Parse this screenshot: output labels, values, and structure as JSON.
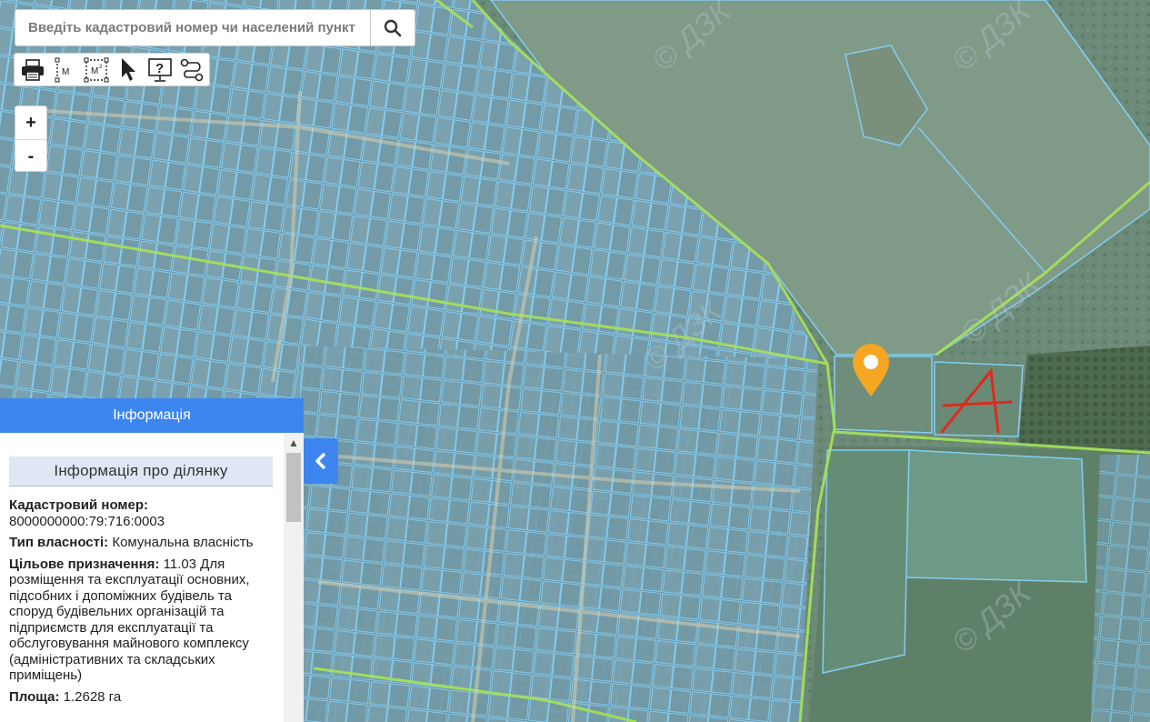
{
  "search": {
    "placeholder": "Введіть кадастровий номер чи населений пункт"
  },
  "toolbar": {
    "icons": [
      "printer-icon",
      "measure-distance-icon",
      "measure-area-icon",
      "pointer-icon",
      "help-icon",
      "route-icon"
    ],
    "measure_label": "M"
  },
  "zoom": {
    "plus": "+",
    "minus": "-"
  },
  "panel": {
    "header": "Інформація",
    "section_title": "Інформація про ділянку",
    "cadastral_label": "Кадастровий номер:",
    "cadastral_value": "8000000000:79:716:0003",
    "ownership_label": "Тип власності:",
    "ownership_value": "Комунальна власність",
    "purpose_label": "Цільове призначення:",
    "purpose_value": "11.03 Для розміщення та експлуатації основних, підсобних і допоміжних будівель та споруд будівельних організацій та підприємств для експлуатації та обслуговування майнового комплексу (адміністративних та складських приміщень)",
    "area_label": "Площа:",
    "area_value": "1.2628 га"
  },
  "map": {
    "marker_color": "#f5a623",
    "annotation": "A",
    "annotation_color": "#e0281e",
    "parcel_color": "#7ec8f0",
    "road_color": "#9fe05a"
  }
}
